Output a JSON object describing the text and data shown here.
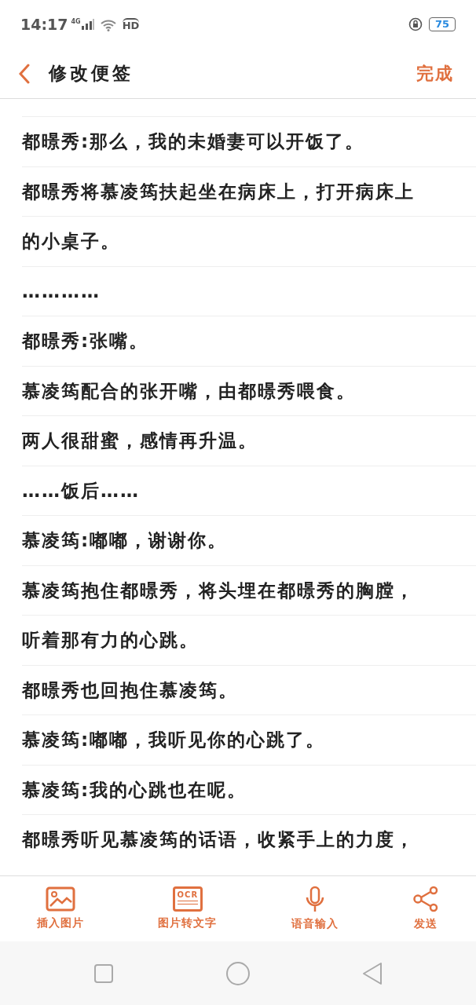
{
  "status_bar": {
    "time": "14:17",
    "network": "4G",
    "hd": "HD",
    "battery": "75"
  },
  "header": {
    "title": "修改便签",
    "action": "完成"
  },
  "lines": [
    "都暻秀:那么，我的未婚妻可以开饭了。",
    "都暻秀将慕凌筠扶起坐在病床上，打开病床上",
    "的小桌子。",
    "…………",
    "都暻秀:张嘴。",
    "慕凌筠配合的张开嘴，由都暻秀喂食。",
    "两人很甜蜜，感情再升温。",
    "……饭后……",
    "慕凌筠:嘟嘟，谢谢你。",
    "慕凌筠抱住都暻秀，将头埋在都暻秀的胸膛，",
    "听着那有力的心跳。",
    "都暻秀也回抱住慕凌筠。",
    "慕凌筠:嘟嘟，我听见你的心跳了。",
    "慕凌筠:我的心跳也在呢。",
    "都暻秀听见慕凌筠的话语，收紧手上的力度，"
  ],
  "toolbar": [
    {
      "kind": "image",
      "label": "插入图片"
    },
    {
      "kind": "ocr",
      "label": "图片转文字",
      "icon_text": "OCR"
    },
    {
      "kind": "mic",
      "label": "语音输入"
    },
    {
      "kind": "share",
      "label": "发送"
    }
  ]
}
